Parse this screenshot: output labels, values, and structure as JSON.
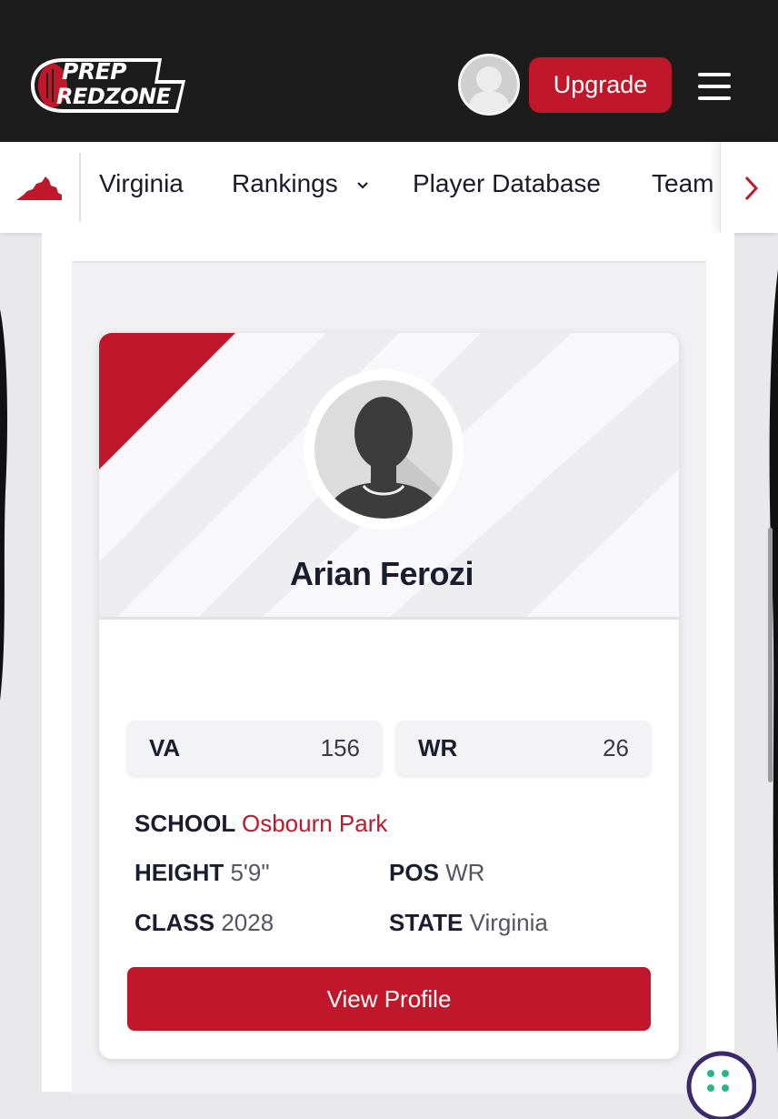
{
  "header": {
    "logo_line1": "PREP",
    "logo_line2": "REDZONE",
    "upgrade_label": "Upgrade"
  },
  "nav": {
    "state_label": "Virginia",
    "items": [
      {
        "label": "Rankings"
      },
      {
        "label": "Player Database"
      },
      {
        "label": "Team"
      }
    ]
  },
  "player": {
    "name": "Arian Ferozi",
    "rankings": [
      {
        "label": "VA",
        "value": "156"
      },
      {
        "label": "WR",
        "value": "26"
      }
    ],
    "school_label": "SCHOOL",
    "school": "Osbourn Park",
    "height_label": "HEIGHT",
    "height": "5'9\"",
    "pos_label": "POS",
    "pos": "WR",
    "class_label": "CLASS",
    "class": "2028",
    "state_label": "STATE",
    "state": "Virginia",
    "view_profile_label": "View Profile"
  },
  "colors": {
    "brand_red": "#c0182a",
    "topbar_bg": "#1c1c1c"
  }
}
